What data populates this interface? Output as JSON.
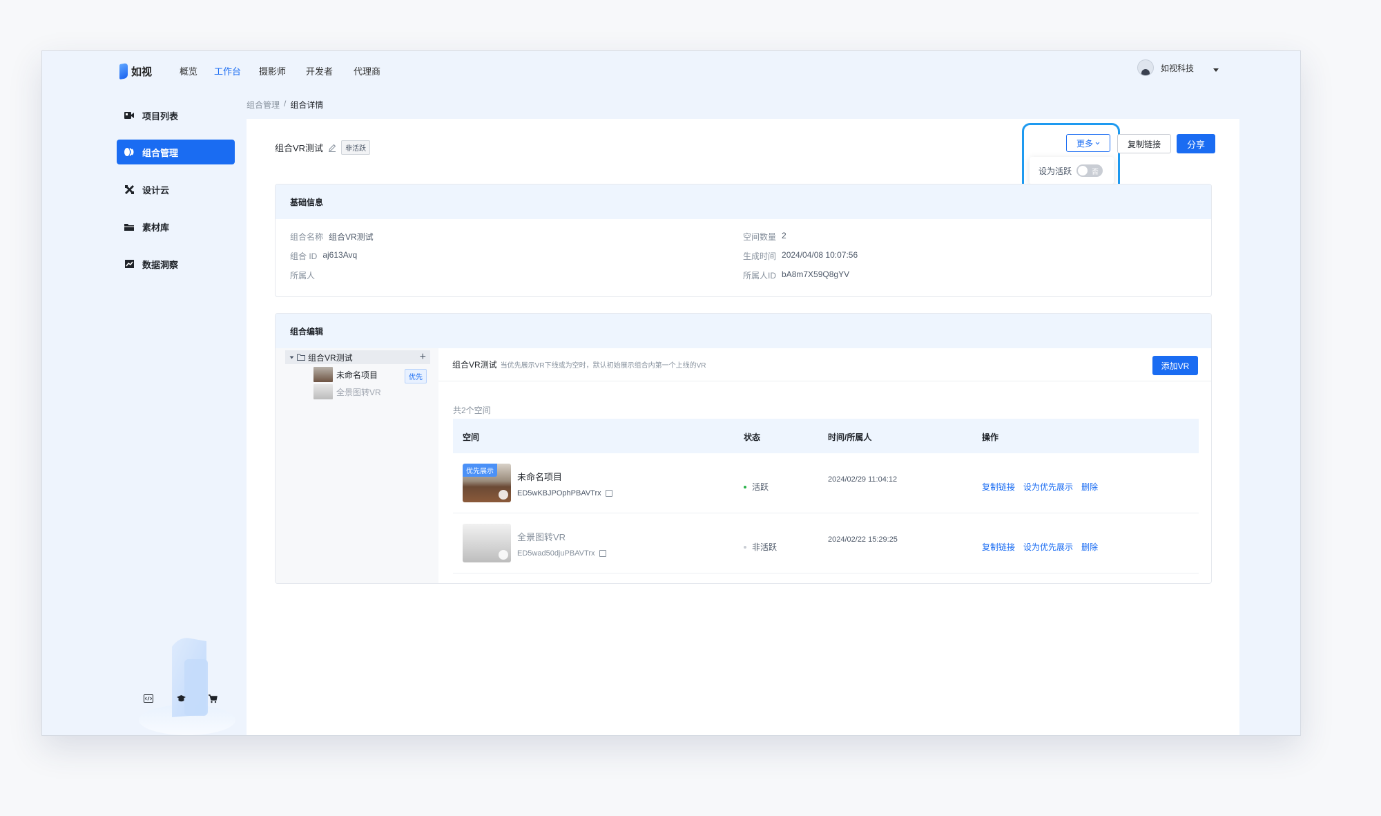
{
  "app": {
    "logo_text": "如视"
  },
  "nav": {
    "items": [
      {
        "label": "概览",
        "active": false
      },
      {
        "label": "工作台",
        "active": true
      },
      {
        "label": "摄影师",
        "active": false
      },
      {
        "label": "开发者",
        "active": false
      },
      {
        "label": "代理商",
        "active": false
      }
    ],
    "user_name": "如视科技"
  },
  "sidebar": {
    "items": [
      {
        "label": "项目列表",
        "icon": "video-icon",
        "active": false
      },
      {
        "label": "组合管理",
        "icon": "combine-icon",
        "active": true
      },
      {
        "label": "设计云",
        "icon": "design-tools-icon",
        "active": false
      },
      {
        "label": "素材库",
        "icon": "folder-icon",
        "active": false
      },
      {
        "label": "数据洞察",
        "icon": "chart-icon",
        "active": false
      }
    ],
    "bottom_icons": [
      "code-icon",
      "graduation-cap-icon",
      "cart-icon"
    ]
  },
  "breadcrumb": {
    "parent": "组合管理",
    "separator": "/",
    "current": "组合详情"
  },
  "header": {
    "title": "组合VR测试",
    "status_badge": "非活跃",
    "more_label": "更多",
    "copy_link_label": "复制链接",
    "share_label": "分享",
    "dropdown": {
      "set_active_label": "设为活跃",
      "toggle_text": "否",
      "toggle_on": false
    }
  },
  "basic_info": {
    "title": "基础信息",
    "group_name_label": "组合名称",
    "group_name": "组合VR测试",
    "group_id_label": "组合 ID",
    "group_id": "aj613Avq",
    "owner_label": "所属人",
    "owner": "",
    "space_count_label": "空间数量",
    "space_count": "2",
    "created_label": "生成时间",
    "created": "2024/04/08 10:07:56",
    "owner_id_label": "所属人ID",
    "owner_id": "bA8m7X59Q8gYV"
  },
  "edit": {
    "title": "组合编辑",
    "tree": {
      "root_label": "组合VR测试",
      "children": [
        {
          "label": "未命名项目",
          "badge": "优先",
          "dim": false
        },
        {
          "label": "全景图转VR",
          "badge": "",
          "dim": true
        }
      ]
    },
    "right_title": "组合VR测试",
    "hint": "当优先展示VR下线或为空时，默认初始展示组合内第一个上线的VR",
    "add_label": "添加VR",
    "count_text": "共2个空间",
    "columns": [
      "空间",
      "状态",
      "时间/所属人",
      "操作"
    ],
    "rows": [
      {
        "name": "未命名项目",
        "id": "ED5wKBJPOphPBAVTrx",
        "tag": "优先展示",
        "status": "活跃",
        "status_color": "#2bb34a",
        "time": "2024/02/29 11:04:12",
        "ops": [
          "复制链接",
          "设为优先展示",
          "删除"
        ]
      },
      {
        "name": "全景图转VR",
        "id": "ED5wad50djuPBAVTrx",
        "tag": "",
        "status": "非活跃",
        "status_color": "#c9cdd4",
        "time": "2024/02/22 15:29:25",
        "ops": [
          "复制链接",
          "设为优先展示",
          "删除"
        ]
      }
    ]
  }
}
